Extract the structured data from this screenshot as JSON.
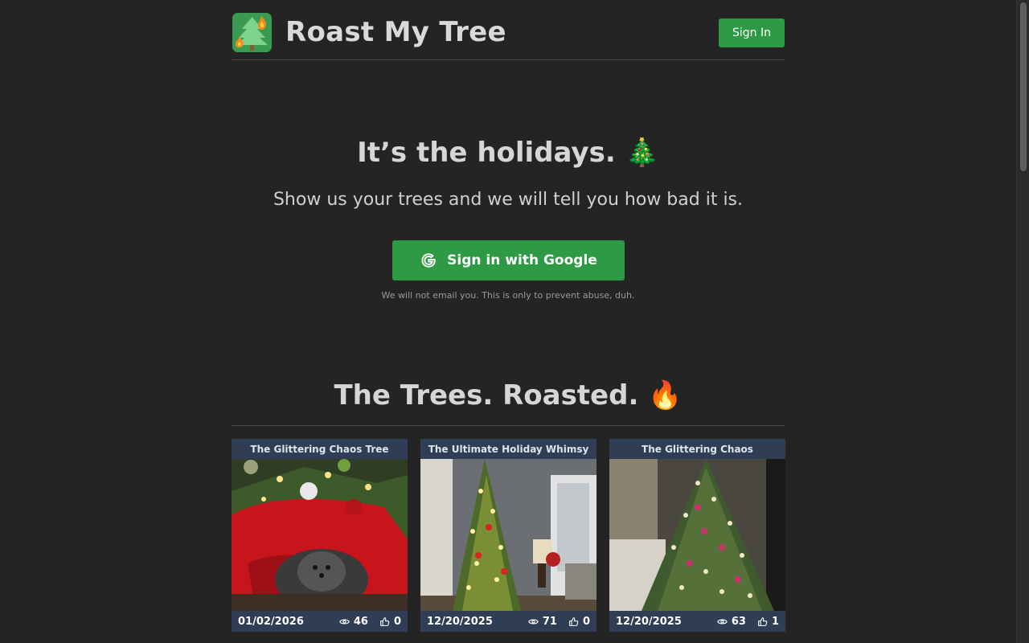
{
  "header": {
    "site_title": "Roast My Tree",
    "sign_in_label": "Sign In"
  },
  "hero": {
    "title": "It’s the holidays. 🎄",
    "subtitle": "Show us your trees and we will tell you how bad it is.",
    "google_button_label": "Sign in with Google",
    "disclaimer": "We will not email you. This is only to prevent abuse, duh."
  },
  "section": {
    "title": "The Trees. Roasted. 🔥"
  },
  "cards": [
    {
      "title": "The Glittering Chaos Tree",
      "date": "01/02/2026",
      "views": "46",
      "likes": "0"
    },
    {
      "title": "The Ultimate Holiday Whimsy",
      "date": "12/20/2025",
      "views": "71",
      "likes": "0"
    },
    {
      "title": "The Glittering Chaos",
      "date": "12/20/2025",
      "views": "63",
      "likes": "1"
    }
  ],
  "colors": {
    "background": "#242424",
    "accent_green": "#2e9a45",
    "card_header": "#2f3e55"
  },
  "icons": {
    "logo": "burning-tree-logo",
    "google": "google-g-icon",
    "views": "eye-icon",
    "likes": "thumbs-up-icon"
  }
}
